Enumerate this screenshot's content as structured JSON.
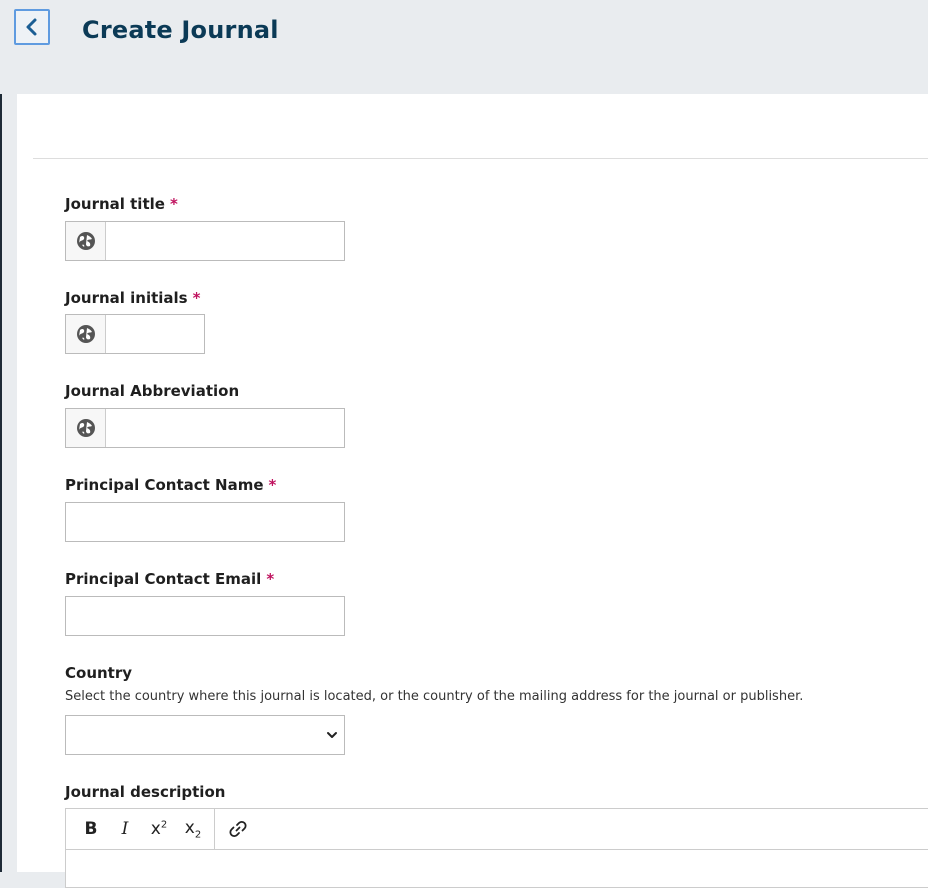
{
  "header": {
    "title": "Create Journal",
    "back_icon": "chevron-left-icon"
  },
  "form": {
    "journal_title": {
      "label": "Journal title",
      "required_mark": "*",
      "value": "",
      "locale_icon": "globe-icon"
    },
    "journal_initials": {
      "label": "Journal initials",
      "required_mark": "*",
      "value": "",
      "locale_icon": "globe-icon"
    },
    "journal_abbreviation": {
      "label": "Journal Abbreviation",
      "value": "",
      "locale_icon": "globe-icon"
    },
    "contact_name": {
      "label": "Principal Contact Name",
      "required_mark": "*",
      "value": ""
    },
    "contact_email": {
      "label": "Principal Contact Email",
      "required_mark": "*",
      "value": ""
    },
    "country": {
      "label": "Country",
      "description": "Select the country where this journal is located, or the country of the mailing address for the journal or publisher.",
      "selected": ""
    },
    "description": {
      "label": "Journal description",
      "toolbar": [
        "bold-icon",
        "italic-icon",
        "superscript-icon",
        "subscript-icon",
        "link-icon"
      ]
    }
  },
  "colors": {
    "title": "#0b3a56",
    "required": "#c0135f",
    "back_border": "#5f9be0"
  }
}
